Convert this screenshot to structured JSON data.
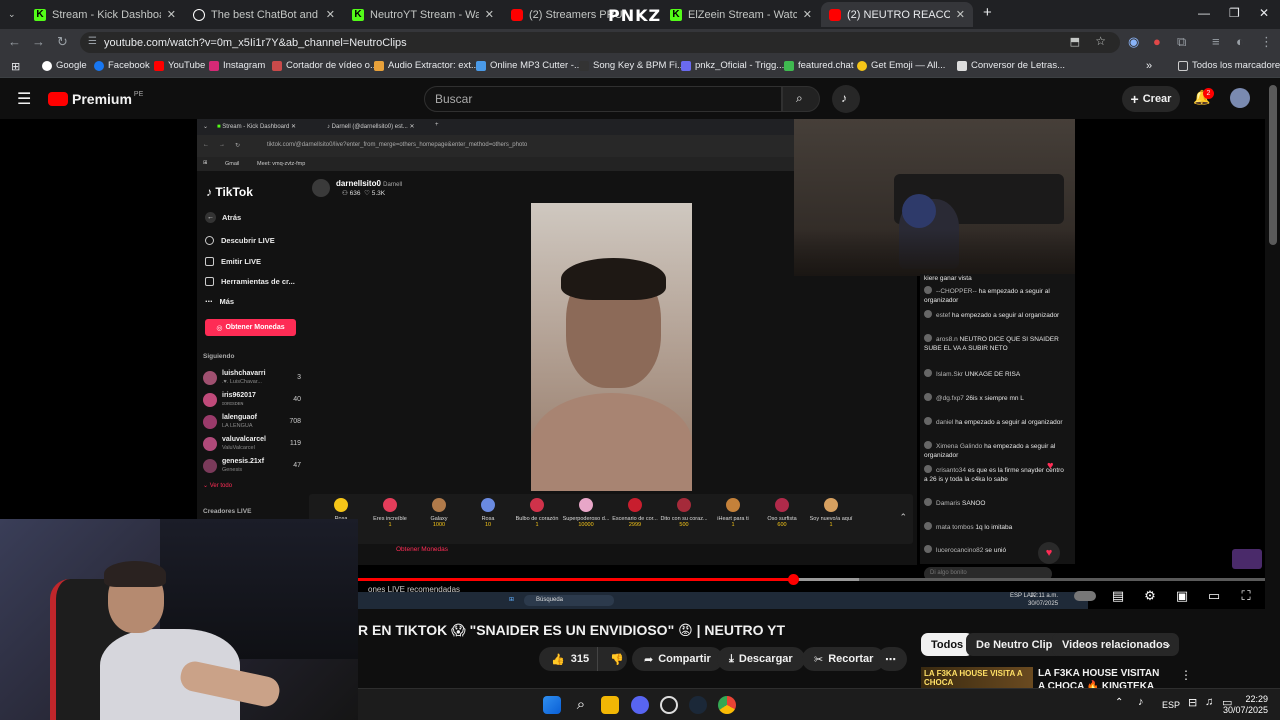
{
  "browser": {
    "tabs": [
      {
        "title": "Stream - Kick Dashboard",
        "favicon": "kick",
        "color": "#53fc18"
      },
      {
        "title": "The best ChatBot and Widgets",
        "favicon": "streamelements",
        "color": "#ffffff"
      },
      {
        "title": "NeutroYT Stream - Watch Live",
        "favicon": "kick",
        "color": "#53fc18"
      },
      {
        "title": "(2)  Streamers PRU",
        "favicon": "youtube",
        "color": "#ff0000"
      },
      {
        "title": "ElZeein Stream - Watch Live on",
        "favicon": "kick",
        "color": "#53fc18"
      },
      {
        "title": "(2) NEUTRO REACCIONA A",
        "favicon": "youtube",
        "color": "#ff0000"
      }
    ],
    "new_tab": "+",
    "overlay_logo": "PNKZ",
    "url": "youtube.com/watch?v=0m_x5Ii1r7Y&ab_channel=NeutroClips",
    "bookmarks": [
      "Google",
      "Facebook",
      "YouTube",
      "Instagram",
      "Cortador de vídeo o...",
      "Audio Extractor: ext...",
      "Online MP3 Cutter -...",
      "Song Key & BPM Fi...",
      "pnkz_Oficial - Trigg...",
      "featured.chat",
      "Get Emoji — All...",
      "Conversor de Letras..."
    ],
    "all_bookmarks": "Todos los marcadores"
  },
  "youtube": {
    "logo": "Premium",
    "region": "PE",
    "search_placeholder": "Buscar",
    "create_label": "Crear",
    "notif_count": "2",
    "title_visible": "R EN TIKTOK 😱 \"SNAIDER ES UN ENVIDIOSO\" 😡 | NEUTRO YT",
    "likes": "315",
    "share": "Compartir",
    "download": "Descargar",
    "clip": "Recortar",
    "more": "⋯",
    "chips": [
      "Todos",
      "De Neutro Clips",
      "Videos relacionados"
    ],
    "progress": 0.48,
    "rec_thumb_text": "LA F3KA HOUSE VISITA A CHOCA",
    "rec_title": "LA F3KA HOUSE VISITAN A CHOCA 🔥 KINGTEKA LE..."
  },
  "inner": {
    "tabs": [
      "Stream - Kick Dashboard",
      "Darnell (@darnellsito0) est..."
    ],
    "url": "tiktok.com/@darnellsito0/live?enter_from_merge=others_homepage&enter_method=others_photo",
    "bookmarks": [
      "Gmail",
      "Meet: vmq-zvtz-fmp"
    ],
    "tiktok_logo": "TikTok",
    "back": "Atrás",
    "nav": [
      "Descubrir LIVE",
      "Emitir LIVE",
      "Herramientas de cr...",
      "Más"
    ],
    "coins_btn": "Obtener Monedas",
    "following_header": "Siguiendo",
    "following": [
      {
        "name": "luishchavarri",
        "sub": ".♥. LuisChavar...",
        "count": "3"
      },
      {
        "name": "iris962017",
        "sub": "ɪᴏʀɪsᴅᴇɴ",
        "count": "40"
      },
      {
        "name": "lalenguaof",
        "sub": "LA LENGUA",
        "count": "708"
      },
      {
        "name": "valuvalcarcel",
        "sub": "ValuValcarcel",
        "count": "119"
      },
      {
        "name": "genesis.21xf",
        "sub": "Genesis",
        "count": "47"
      }
    ],
    "see_all": "Ver todo",
    "creators_live": "Creadores LIVE",
    "streamer_name": "darnellsito0",
    "streamer_sub": "Darnell",
    "viewers": "636",
    "likes": "5.3K",
    "gifts": [
      {
        "name": "Rosa",
        "price": "1"
      },
      {
        "name": "Eres increíble",
        "price": "1"
      },
      {
        "name": "Galaxy",
        "price": "1000"
      },
      {
        "name": "Rosa",
        "price": "10"
      },
      {
        "name": "Bulbo de corazón",
        "price": "1"
      },
      {
        "name": "Superpoderoso d...",
        "price": "10000"
      },
      {
        "name": "Escenario de cor...",
        "price": "2999"
      },
      {
        "name": "Dito con su coraz...",
        "price": "500"
      },
      {
        "name": "iHeart para ti",
        "price": "1"
      },
      {
        "name": "Oso surfista",
        "price": "600"
      },
      {
        "name": "Soy nuevo/a aquí",
        "price": "1"
      }
    ],
    "coins_count": "93",
    "coins_label": "Obtener Monedas",
    "recommended": "ones LIVE recomendadas",
    "chat": [
      {
        "user": "",
        "text": "kiere ganar vista"
      },
      {
        "user": "--CHOPPER--",
        "text": "ha empezado a seguir al organizador"
      },
      {
        "user": "estef",
        "text": "ha empezado a seguir al organizador"
      },
      {
        "user": "aros8.n",
        "text": "NEUTRO DICE QUE SI SNAIDER SUBE EL VA A SUBIR NETO"
      },
      {
        "user": "Islam.Skr",
        "text": "UNKAGE DE RISA"
      },
      {
        "user": "@dg.fxp7",
        "text": "26is x siempre mn L"
      },
      {
        "user": "daniel",
        "text": "ha empezado a seguir al organizador"
      },
      {
        "user": "Ximena Galindo",
        "text": "ha empezado a seguir al organizador"
      },
      {
        "user": "crisanto34",
        "text": "es que es la firme snayder centro a 26 is y toda la c4ka lo sabe"
      },
      {
        "user": "Damaris",
        "text": "SANOO"
      },
      {
        "user": "mata tombos",
        "text": "1q lo imitaba"
      },
      {
        "user": "lucerocancino82",
        "text": "se unió"
      }
    ],
    "chat_placeholder": "Di algo bonito",
    "inner_search": "Búsqueda",
    "inner_time": "12:11 a.m.",
    "inner_date": "30/07/2025",
    "inner_lang": "ESP LAA"
  },
  "taskbar": {
    "lang": "ESP",
    "time": "22:29",
    "date": "30/07/2025"
  }
}
